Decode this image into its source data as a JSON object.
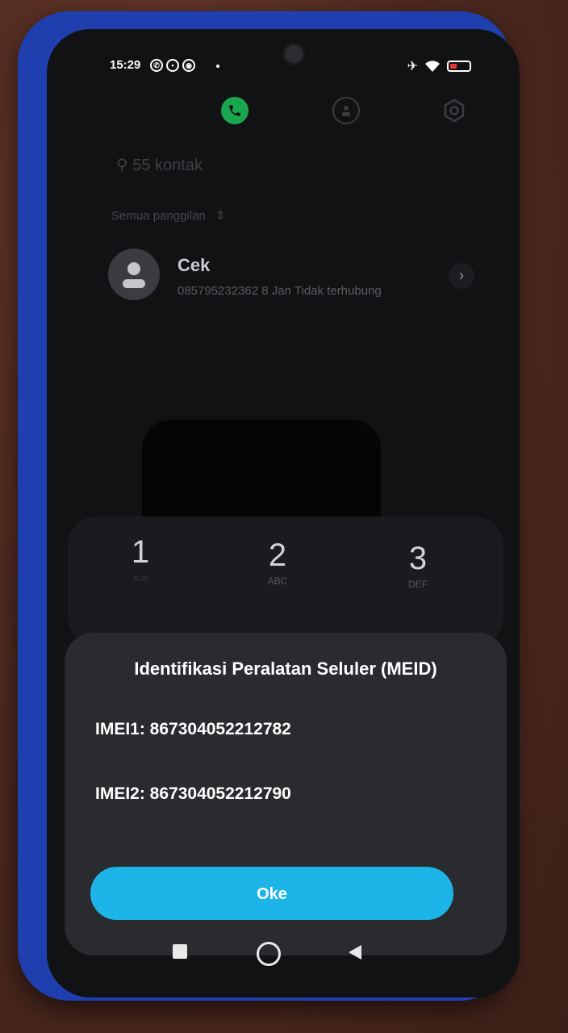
{
  "status_bar": {
    "time": "15:29"
  },
  "contacts": {
    "search_placeholder": "55 kontak",
    "filter_label": "Semua panggilan"
  },
  "recent_call": {
    "name": "Cek",
    "number": "085795232362",
    "date": "8 Jan",
    "status": "Tidak terhubung"
  },
  "keypad": [
    {
      "digit": "1",
      "letters": "○.○"
    },
    {
      "digit": "2",
      "letters": "ABC"
    },
    {
      "digit": "3",
      "letters": "DEF"
    }
  ],
  "dialog": {
    "title": "Identifikasi Peralatan Seluler (MEID)",
    "imei1": "IMEI1: 867304052212782",
    "imei2": "IMEI2: 867304052212790",
    "ok_label": "Oke"
  },
  "colors": {
    "phone_tab_active": "#1aa64f",
    "ok_button": "#1db4e8"
  }
}
